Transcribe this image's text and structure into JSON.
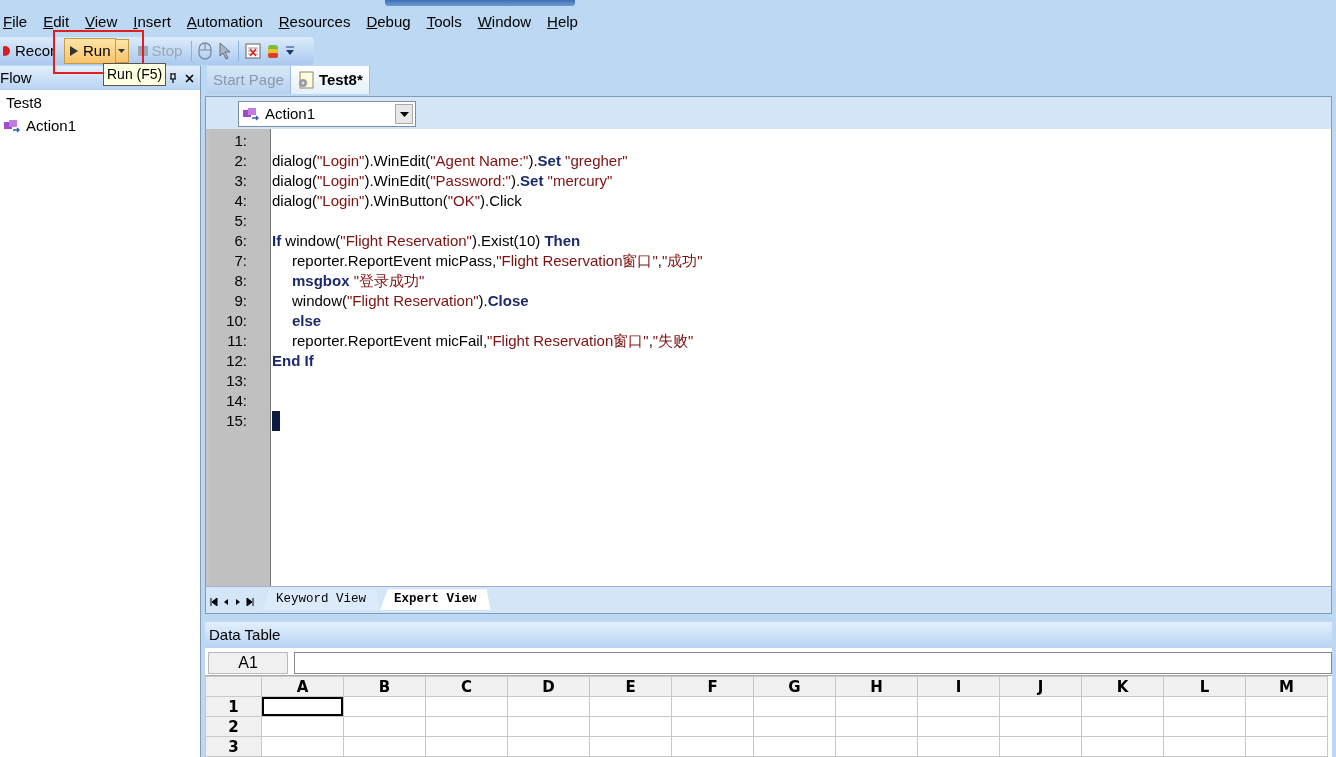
{
  "menu": [
    {
      "label": "File"
    },
    {
      "label": "Edit"
    },
    {
      "label": "View"
    },
    {
      "label": "Insert"
    },
    {
      "label": "Automation"
    },
    {
      "label": "Resources"
    },
    {
      "label": "Debug"
    },
    {
      "label": "Tools"
    },
    {
      "label": "Window"
    },
    {
      "label": "Help"
    }
  ],
  "toolbar": {
    "record": {
      "label": "Recor",
      "disabled": false
    },
    "run": {
      "label": "Run",
      "disabled": false
    },
    "stop": {
      "label": "Stop",
      "disabled": true
    }
  },
  "tooltip": "Run (F5)",
  "flow_pane": {
    "title": "Flow",
    "tree": [
      {
        "label": "Test8",
        "children": [
          {
            "label": "Action1"
          }
        ]
      }
    ]
  },
  "doc_tabs": [
    {
      "label": "Start Page",
      "selected": false
    },
    {
      "label": "Test8*",
      "selected": true
    }
  ],
  "action_select": "Action1",
  "code": [
    {
      "number": "1:",
      "cursor": false
    },
    {
      "number": "2:",
      "indented": false,
      "cursor": false,
      "segments": [
        {
          "kind": "p",
          "text": "dialog("
        },
        {
          "kind": "s",
          "text": "\"Login\""
        },
        {
          "kind": "p",
          "text": ").WinEdit("
        },
        {
          "kind": "s",
          "text": "\"Agent Name:\""
        },
        {
          "kind": "p",
          "text": ")."
        },
        {
          "kind": "k",
          "text": "Set"
        },
        {
          "kind": "s",
          "text": " \"gregher\""
        }
      ]
    },
    {
      "number": "3:",
      "indented": false,
      "cursor": false,
      "segments": [
        {
          "kind": "p",
          "text": "dialog("
        },
        {
          "kind": "s",
          "text": "\"Login\""
        },
        {
          "kind": "p",
          "text": ").WinEdit("
        },
        {
          "kind": "s",
          "text": "\"Password:\""
        },
        {
          "kind": "p",
          "text": ")."
        },
        {
          "kind": "k",
          "text": "Set"
        },
        {
          "kind": "s",
          "text": " \"mercury\""
        }
      ]
    },
    {
      "number": "4:",
      "indented": false,
      "cursor": false,
      "segments": [
        {
          "kind": "p",
          "text": "dialog("
        },
        {
          "kind": "s",
          "text": "\"Login\""
        },
        {
          "kind": "p",
          "text": ").WinButton("
        },
        {
          "kind": "s",
          "text": "\"OK\""
        },
        {
          "kind": "p",
          "text": ").Click"
        }
      ]
    },
    {
      "number": "5:",
      "cursor": false
    },
    {
      "number": "6:",
      "indented": false,
      "cursor": false,
      "segments": [
        {
          "kind": "k",
          "text": "If"
        },
        {
          "kind": "p",
          "text": " window("
        },
        {
          "kind": "s",
          "text": "\"Flight Reservation\""
        },
        {
          "kind": "p",
          "text": ").Exist(10) "
        },
        {
          "kind": "k",
          "text": "Then"
        }
      ]
    },
    {
      "number": "7:",
      "indented": true,
      "cursor": false,
      "segments": [
        {
          "kind": "p",
          "text": "reporter.ReportEvent micPass,"
        },
        {
          "kind": "s",
          "text": "\"Flight Reservation窗口\""
        },
        {
          "kind": "p",
          "text": ","
        },
        {
          "kind": "s",
          "text": "\"成功\""
        }
      ]
    },
    {
      "number": "8:",
      "indented": true,
      "cursor": false,
      "segments": [
        {
          "kind": "k",
          "text": "msgbox"
        },
        {
          "kind": "s",
          "text": " \"登录成功\""
        }
      ]
    },
    {
      "number": "9:",
      "indented": true,
      "cursor": false,
      "segments": [
        {
          "kind": "p",
          "text": "window("
        },
        {
          "kind": "s",
          "text": "\"Flight Reservation\""
        },
        {
          "kind": "p",
          "text": ")."
        },
        {
          "kind": "k",
          "text": "Close"
        }
      ]
    },
    {
      "number": "10:",
      "indented": true,
      "cursor": false,
      "segments": [
        {
          "kind": "k",
          "text": "else"
        }
      ]
    },
    {
      "number": "11:",
      "indented": true,
      "cursor": false,
      "segments": [
        {
          "kind": "p",
          "text": "reporter.ReportEvent micFail,"
        },
        {
          "kind": "s",
          "text": "\"Flight Reservation窗口\""
        },
        {
          "kind": "p",
          "text": ","
        },
        {
          "kind": "s",
          "text": "\"失败\""
        }
      ]
    },
    {
      "number": "12:",
      "indented": false,
      "cursor": false,
      "segments": [
        {
          "kind": "k",
          "text": "End If"
        }
      ]
    },
    {
      "number": "13:",
      "cursor": false
    },
    {
      "number": "14:",
      "cursor": false
    },
    {
      "number": "15:",
      "cursor": true
    }
  ],
  "view_tabs": [
    {
      "label": "Keyword View",
      "selected": false
    },
    {
      "label": "Expert View",
      "selected": true
    }
  ],
  "data_table": {
    "title": "Data Table",
    "cell_ref": "A1",
    "columns": [
      "A",
      "B",
      "C",
      "D",
      "E",
      "F",
      "G",
      "H",
      "I",
      "J",
      "K",
      "L",
      "M"
    ],
    "rows": [
      {
        "label": "1",
        "cells": [
          {
            "selected": true
          },
          {
            "selected": false
          },
          {
            "selected": false
          },
          {
            "selected": false
          },
          {
            "selected": false
          },
          {
            "selected": false
          },
          {
            "selected": false
          },
          {
            "selected": false
          },
          {
            "selected": false
          },
          {
            "selected": false
          },
          {
            "selected": false
          },
          {
            "selected": false
          },
          {
            "selected": false
          }
        ]
      },
      {
        "label": "2",
        "cells": [
          {
            "selected": false
          },
          {
            "selected": false
          },
          {
            "selected": false
          },
          {
            "selected": false
          },
          {
            "selected": false
          },
          {
            "selected": false
          },
          {
            "selected": false
          },
          {
            "selected": false
          },
          {
            "selected": false
          },
          {
            "selected": false
          },
          {
            "selected": false
          },
          {
            "selected": false
          },
          {
            "selected": false
          }
        ]
      },
      {
        "label": "3",
        "cells": [
          {
            "selected": false
          },
          {
            "selected": false
          },
          {
            "selected": false
          },
          {
            "selected": false
          },
          {
            "selected": false
          },
          {
            "selected": false
          },
          {
            "selected": false
          },
          {
            "selected": false
          },
          {
            "selected": false
          },
          {
            "selected": false
          },
          {
            "selected": false
          },
          {
            "selected": false
          },
          {
            "selected": false
          }
        ]
      }
    ]
  }
}
